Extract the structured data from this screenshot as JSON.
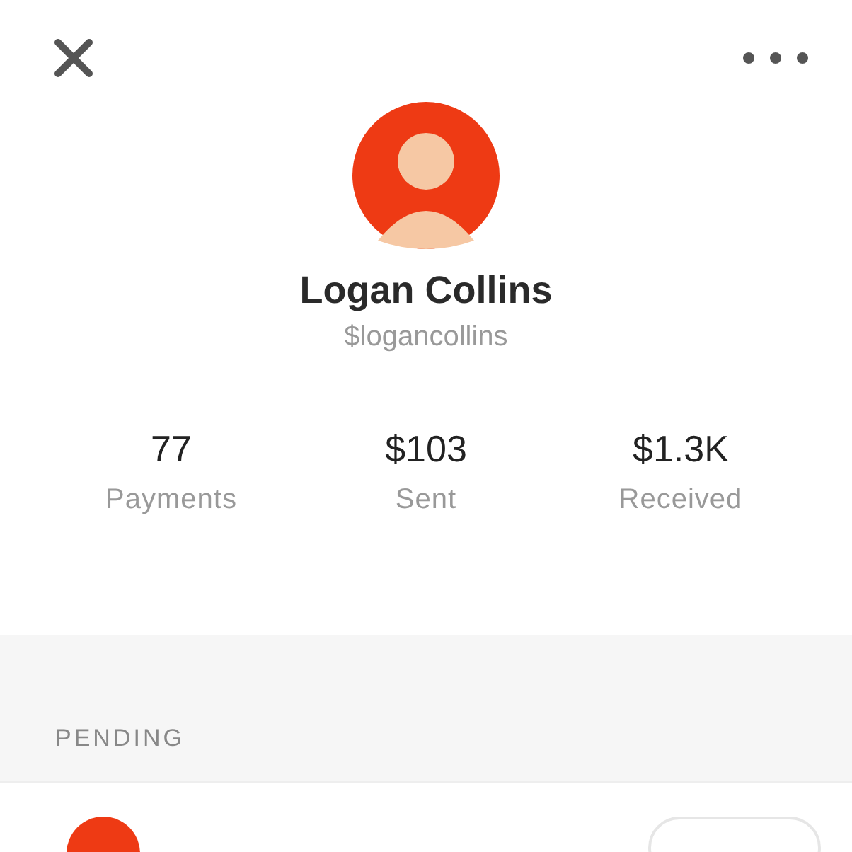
{
  "profile": {
    "name": "Logan Collins",
    "handle": "$logancollins"
  },
  "stats": [
    {
      "value": "77",
      "label": "Payments"
    },
    {
      "value": "$103",
      "label": "Sent"
    },
    {
      "value": "$1.3K",
      "label": "Received"
    }
  ],
  "pending": {
    "header": "PENDING"
  }
}
